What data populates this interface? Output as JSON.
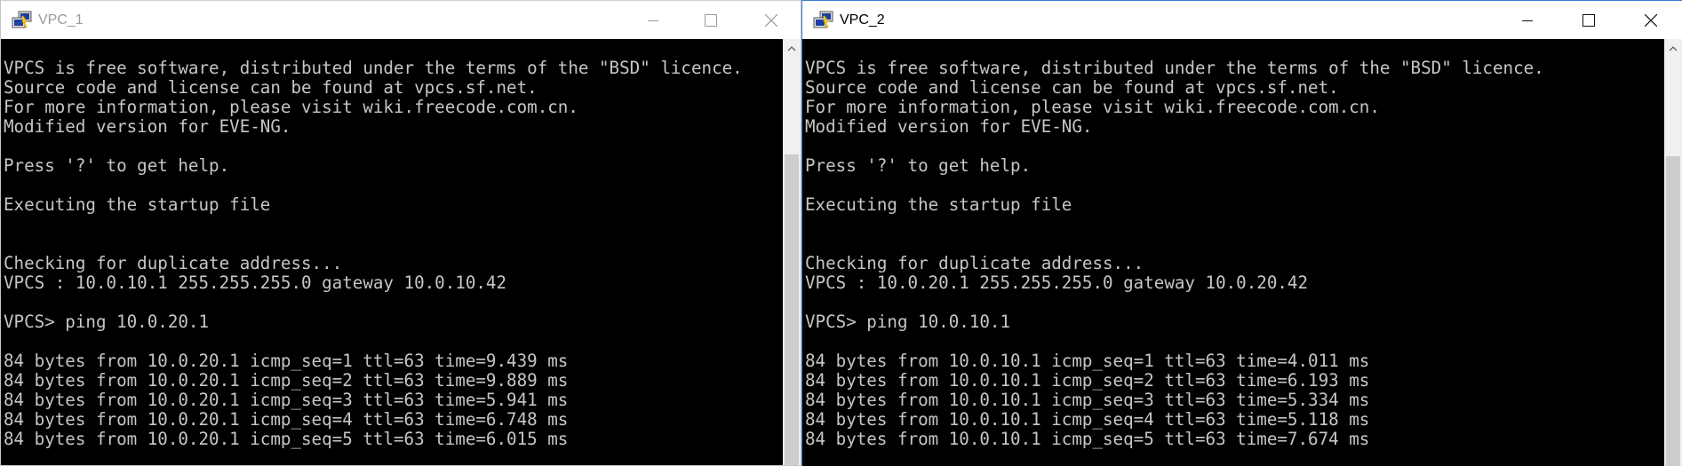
{
  "windows": [
    {
      "title": "VPC_1",
      "lines": [
        "VPCS is free software, distributed under the terms of the \"BSD\" licence.",
        "Source code and license can be found at vpcs.sf.net.",
        "For more information, please visit wiki.freecode.com.cn.",
        "Modified version for EVE-NG.",
        "",
        "Press '?' to get help.",
        "",
        "Executing the startup file",
        "",
        "",
        "Checking for duplicate address...",
        "VPCS : 10.0.10.1 255.255.255.0 gateway 10.0.10.42",
        "",
        "VPCS> ping 10.0.20.1",
        "",
        "84 bytes from 10.0.20.1 icmp_seq=1 ttl=63 time=9.439 ms",
        "84 bytes from 10.0.20.1 icmp_seq=2 ttl=63 time=9.889 ms",
        "84 bytes from 10.0.20.1 icmp_seq=3 ttl=63 time=5.941 ms",
        "84 bytes from 10.0.20.1 icmp_seq=4 ttl=63 time=6.748 ms",
        "84 bytes from 10.0.20.1 icmp_seq=5 ttl=63 time=6.015 ms"
      ]
    },
    {
      "title": "VPC_2",
      "lines": [
        "VPCS is free software, distributed under the terms of the \"BSD\" licence.",
        "Source code and license can be found at vpcs.sf.net.",
        "For more information, please visit wiki.freecode.com.cn.",
        "Modified version for EVE-NG.",
        "",
        "Press '?' to get help.",
        "",
        "Executing the startup file",
        "",
        "",
        "Checking for duplicate address...",
        "VPCS : 10.0.20.1 255.255.255.0 gateway 10.0.20.42",
        "",
        "VPCS> ping 10.0.10.1",
        "",
        "84 bytes from 10.0.10.1 icmp_seq=1 ttl=63 time=4.011 ms",
        "84 bytes from 10.0.10.1 icmp_seq=2 ttl=63 time=6.193 ms",
        "84 bytes from 10.0.10.1 icmp_seq=3 ttl=63 time=5.334 ms",
        "84 bytes from 10.0.10.1 icmp_seq=4 ttl=63 time=5.118 ms",
        "84 bytes from 10.0.10.1 icmp_seq=5 ttl=63 time=7.674 ms"
      ]
    }
  ],
  "icons": {
    "app": "putty-terminal-icon",
    "minimize": "minimize-icon",
    "maximize": "maximize-icon",
    "close": "close-icon",
    "scroll_up": "chevron-up-icon"
  },
  "colors": {
    "terminal_bg": "#000000",
    "terminal_fg": "#c6c6c6",
    "active_border": "#3a7bd5",
    "inactive_title": "#9a9a9a"
  }
}
